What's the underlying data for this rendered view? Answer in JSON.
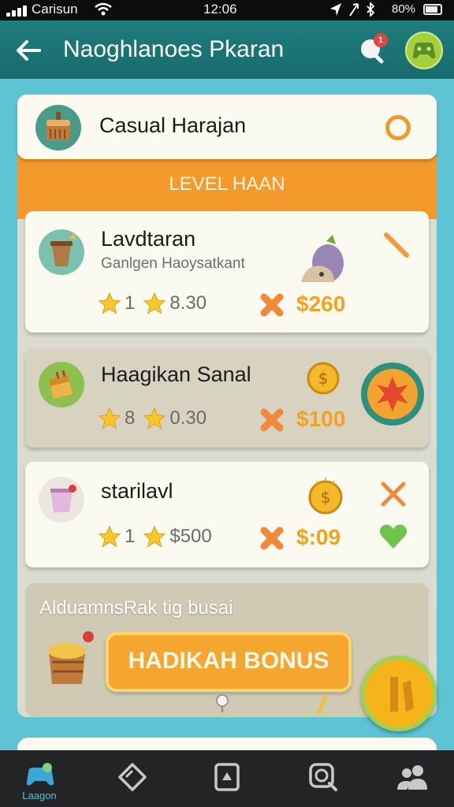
{
  "status_bar": {
    "carrier": "Carisun",
    "time": "12:06",
    "battery": "80%"
  },
  "app_bar": {
    "title": "Naoghlanoes Pkaran",
    "notification_count": "1"
  },
  "header_card": {
    "title": "Casual Harajan"
  },
  "level_banner": {
    "label": "LEVEL HAAN"
  },
  "levels": [
    {
      "name": "Lavdtaran",
      "subtitle": "Ganlgen Haoysatkant",
      "star_count_1": "1",
      "star_count_2": "8.30",
      "price": "$260"
    },
    {
      "name": "Haagikan Sanal",
      "subtitle": "",
      "star_count_1": "8",
      "star_count_2": "0.30",
      "price": "$100"
    },
    {
      "name": "starilavl",
      "subtitle": "",
      "star_count_1": "1",
      "star_count_2": "$500",
      "price": "$:09"
    }
  ],
  "bonus": {
    "caption": "AlduamnsRak tig busai",
    "button_label": "HADIKAH BONUS"
  },
  "bottom_nav": {
    "items": [
      {
        "icon": "game-controller-icon",
        "label": "Laagon"
      },
      {
        "icon": "tag-icon",
        "label": ""
      },
      {
        "icon": "card-icon",
        "label": ""
      },
      {
        "icon": "search-icon",
        "label": ""
      },
      {
        "icon": "people-icon",
        "label": ""
      }
    ]
  },
  "colors": {
    "app_bar": "#1f7d7e",
    "background": "#5ec3d3",
    "accent_orange": "#f49a2c",
    "price_gold": "#f2a21e",
    "fab_green": "#a0d24f"
  }
}
